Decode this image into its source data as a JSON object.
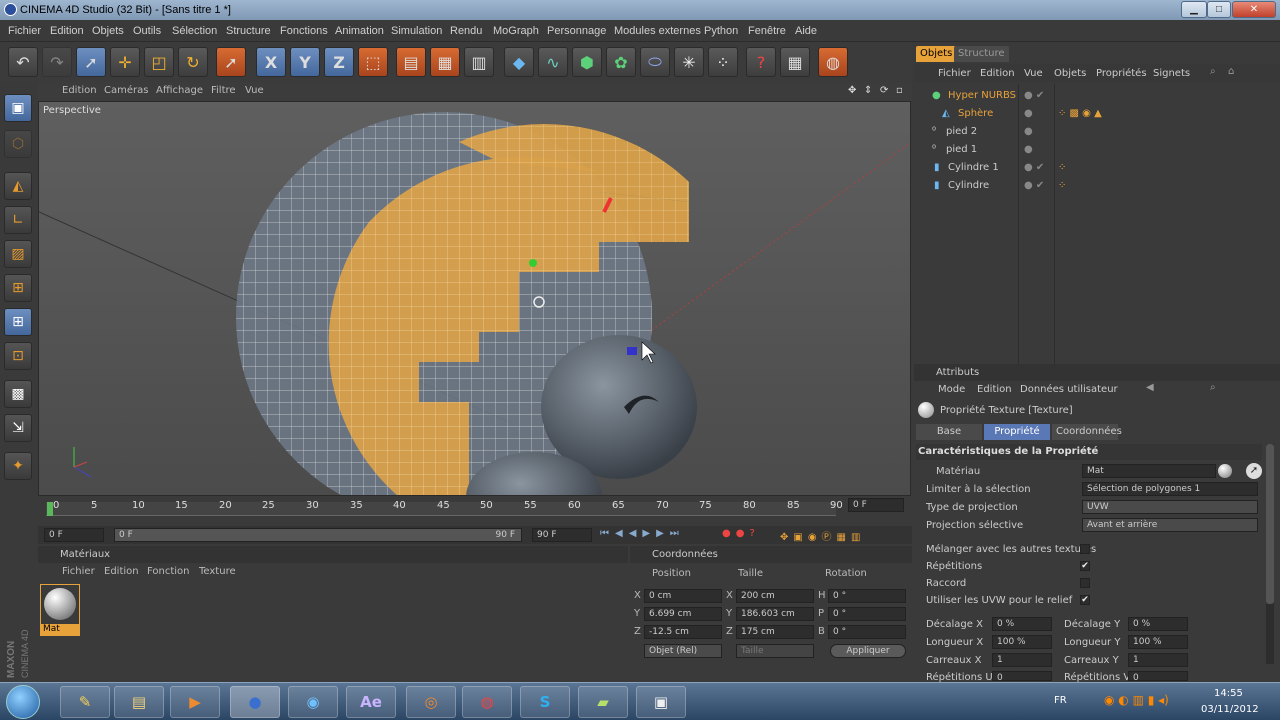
{
  "window": {
    "title": "CINEMA 4D Studio (32 Bit) - [Sans titre 1 *]",
    "min_label": "▁",
    "max_label": "□",
    "close_label": "✕"
  },
  "menu": [
    "Fichier",
    "Edition",
    "Objets",
    "Outils",
    "Sélection",
    "Structure",
    "Fonctions",
    "Animation",
    "Simulation",
    "Rendu",
    "MoGraph",
    "Personnage",
    "Modules externes",
    "Python",
    "Fenêtre",
    "Aide"
  ],
  "toolbar": {
    "icons": [
      "undo-icon",
      "redo-icon",
      "select-arrow-icon",
      "move-icon",
      "scale-icon",
      "rotate-icon",
      "live-select-icon",
      "x-axis-icon",
      "y-axis-icon",
      "z-axis-icon",
      "coordinate-system-icon",
      "render-view-icon",
      "render-picture-icon",
      "render-settings-icon",
      "cube-icon",
      "spline-icon",
      "nurbs-icon",
      "array-icon",
      "deformer-icon",
      "scene-icon",
      "light-icon",
      "help-icon",
      "layout-icon",
      "globe-icon"
    ],
    "axis_labels": [
      "X",
      "Y",
      "Z"
    ]
  },
  "viewport": {
    "menu": [
      "Edition",
      "Caméras",
      "Affichage",
      "Filtre",
      "Vue"
    ],
    "label": "Perspective"
  },
  "timeline": {
    "ticks": [
      "0",
      "5",
      "10",
      "15",
      "20",
      "25",
      "30",
      "35",
      "40",
      "45",
      "50",
      "55",
      "60",
      "65",
      "70",
      "75",
      "80",
      "85",
      "90"
    ],
    "end_field": "0 F",
    "start_field": "0 F",
    "range_start": "0 F",
    "range_end": "90 F",
    "max_field": "90 F"
  },
  "materials": {
    "title": "Matériaux",
    "menu": [
      "Fichier",
      "Edition",
      "Fonction",
      "Texture"
    ],
    "items": [
      {
        "name": "Mat"
      }
    ]
  },
  "coordinates": {
    "title": "Coordonnées",
    "headers": [
      "Position",
      "Taille",
      "Rotation"
    ],
    "rows": [
      {
        "axis": "X",
        "pos": "0 cm",
        "size_axis": "X",
        "size": "200 cm",
        "rot_axis": "H",
        "rot": "0 °"
      },
      {
        "axis": "Y",
        "pos": "6.699 cm",
        "size_axis": "Y",
        "size": "186.603 cm",
        "rot_axis": "P",
        "rot": "0 °"
      },
      {
        "axis": "Z",
        "pos": "-12.5 cm",
        "size_axis": "Z",
        "size": "175 cm",
        "rot_axis": "B",
        "rot": "0 °"
      }
    ],
    "mode": "Objet (Rel)",
    "size_mode": "Taille",
    "apply": "Appliquer"
  },
  "objects": {
    "tabs": [
      "Objets",
      "Structure"
    ],
    "menu": [
      "Fichier",
      "Edition",
      "Vue",
      "Objets",
      "Propriétés",
      "Signets"
    ],
    "items": [
      {
        "name": "Hyper NURBS",
        "indent": 0,
        "color": "#e8a23a"
      },
      {
        "name": "Sphère",
        "indent": 1,
        "color": "#e8a23a"
      },
      {
        "name": "pied 2",
        "indent": 0,
        "color": "#cccccc"
      },
      {
        "name": "pied 1",
        "indent": 0,
        "color": "#cccccc"
      },
      {
        "name": "Cylindre 1",
        "indent": 1,
        "color": "#cccccc"
      },
      {
        "name": "Cylindre",
        "indent": 1,
        "color": "#cccccc"
      }
    ]
  },
  "attributes": {
    "title": "Attributs",
    "menu": [
      "Mode",
      "Edition",
      "Données utilisateur"
    ],
    "header": "Propriété Texture [Texture]",
    "tabs": [
      "Base",
      "Propriété",
      "Coordonnées"
    ],
    "section": "Caractéristiques de la Propriété",
    "fields": [
      {
        "label": "Matériau",
        "value": "Mat"
      },
      {
        "label": "Limiter à la sélection",
        "value": "Sélection de polygones 1"
      },
      {
        "label": "Type de projection",
        "value": "UVW"
      },
      {
        "label": "Projection sélective",
        "value": "Avant et arrière"
      }
    ],
    "checks": [
      {
        "label": "Mélanger avec les autres textures",
        "checked": ""
      },
      {
        "label": "Répétitions",
        "checked": "✔"
      },
      {
        "label": "Raccord",
        "checked": ""
      },
      {
        "label": "Utiliser les UVW pour le relief",
        "checked": "✔"
      }
    ],
    "pairs": [
      {
        "l1": "Décalage X",
        "v1": "0 %",
        "l2": "Décalage Y",
        "v2": "0 %"
      },
      {
        "l1": "Longueur X",
        "v1": "100 %",
        "l2": "Longueur Y",
        "v2": "100 %"
      },
      {
        "l1": "Carreaux X",
        "v1": "1",
        "l2": "Carreaux Y",
        "v2": "1"
      },
      {
        "l1": "Répétitions U",
        "v1": "0",
        "l2": "Répétitions V",
        "v2": "0"
      }
    ]
  },
  "taskbar": {
    "apps": [
      "start-orb",
      "paint-icon",
      "explorer-icon",
      "media-player-icon",
      "cinema4d-icon",
      "quicktime-icon",
      "after-effects-icon",
      "firefox-icon",
      "chrome-icon",
      "skype-icon",
      "notes-icon",
      "camera-icon"
    ],
    "ae_label": "Ae",
    "lang": "FR",
    "time": "14:55",
    "date": "03/11/2012"
  },
  "branding": {
    "maxon": "MAXON",
    "cinema": "CINEMA 4D"
  },
  "colors": {
    "accent": "#e8a23a",
    "selected_tab": "#5a78b5"
  }
}
